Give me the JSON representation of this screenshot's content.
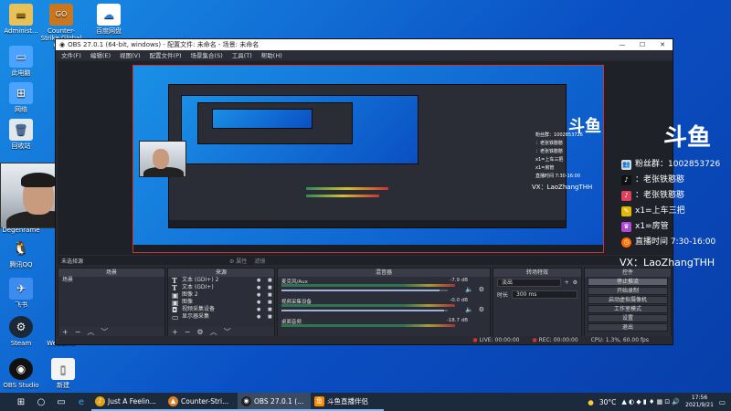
{
  "desktop": {
    "icons": [
      {
        "label": "Administ..."
      },
      {
        "label": "Counter-Strike Global Off..."
      },
      {
        "label": "百度网盘"
      },
      {
        "label": "此电脑"
      },
      {
        "label": "网络"
      },
      {
        "label": "回收站"
      },
      {
        "label": "Degenrame"
      },
      {
        "label": "腾讯QQ"
      },
      {
        "label": "飞书"
      },
      {
        "label": "Steam"
      },
      {
        "label": "WeGame"
      },
      {
        "label": "OBS Studio"
      },
      {
        "label": "新建"
      }
    ]
  },
  "obs": {
    "title": "OBS 27.0.1 (64-bit, windows) - 配置文件: 未命名 - 场景: 未命名",
    "window_controls": {
      "minimize": "—",
      "maximize": "☐",
      "close": "✕"
    },
    "menu": [
      "文件(F)",
      "编辑(E)",
      "视图(V)",
      "配置文件(P)",
      "场景集合(S)",
      "工具(T)",
      "帮助(H)"
    ],
    "docks_bar": {
      "left": "未选择源",
      "properties": "⚙ 属性",
      "filters": "滤镜"
    },
    "scenes": {
      "header": "场景",
      "items": [
        "场景"
      ]
    },
    "sources": {
      "header": "来源",
      "items": [
        "文本 (GDI+) 2",
        "文本 (GDI+)",
        "图像 2",
        "图像",
        "视频采集设备",
        "显示器采集"
      ]
    },
    "mixer": {
      "header": "混音器",
      "channels": [
        {
          "name": "麦克风/Aux",
          "db": "-7.9 dB",
          "level": 0.95
        },
        {
          "name": "视频采集设备",
          "db": "-0.0 dB",
          "level": 0.98
        },
        {
          "name": "桌面音频",
          "db": "-18.7 dB",
          "level": 0.7
        }
      ]
    },
    "transitions": {
      "header": "转场特效",
      "type": "淡出",
      "duration_label": "时长",
      "duration": "300 ms"
    },
    "controls": {
      "header": "控件",
      "buttons": [
        "停止推流",
        "开始录制",
        "启动虚拟摄像机",
        "工作室模式",
        "设置",
        "退出"
      ]
    },
    "status": {
      "live": "LIVE: 00:00:00",
      "rec": "REC: 00:00:00",
      "cpu": "CPU: 1.3%, 60.00 fps"
    }
  },
  "overlay": {
    "logo": "斗鱼",
    "lines": [
      {
        "icon": "fans-group-icon",
        "text": "粉丝群：1002853726",
        "color": "#d9d9d9"
      },
      {
        "icon": "douyin-icon",
        "text": "：老张铁憨憨",
        "color": "#111111"
      },
      {
        "icon": "douyin-icon",
        "text": "：老张铁憨憨",
        "color": "#e3405d"
      },
      {
        "icon": "pencil-icon",
        "text": "x1=上车三把",
        "color": "#e6b800"
      },
      {
        "icon": "gift-icon",
        "text": "x1=房管",
        "color": "#b04bd3"
      },
      {
        "icon": "clock-icon",
        "text": "直播时间 7:30-16:00",
        "color": "#ff6a00"
      }
    ],
    "vx": "VX：LaoZhangTHH"
  },
  "taskbar": {
    "apps": [
      {
        "label": "Just A Feelin...",
        "icon_color": "#e3a21a"
      },
      {
        "label": "Counter-Stri...",
        "icon_color": "#d9822b"
      },
      {
        "label": "OBS 27.0.1 (...",
        "icon_color": "#222222"
      },
      {
        "label": "斗鱼直播伴侣",
        "icon_color": "#ff8a00"
      }
    ],
    "weather": "30°C",
    "time": "17:56",
    "date": "2021/9/21"
  }
}
